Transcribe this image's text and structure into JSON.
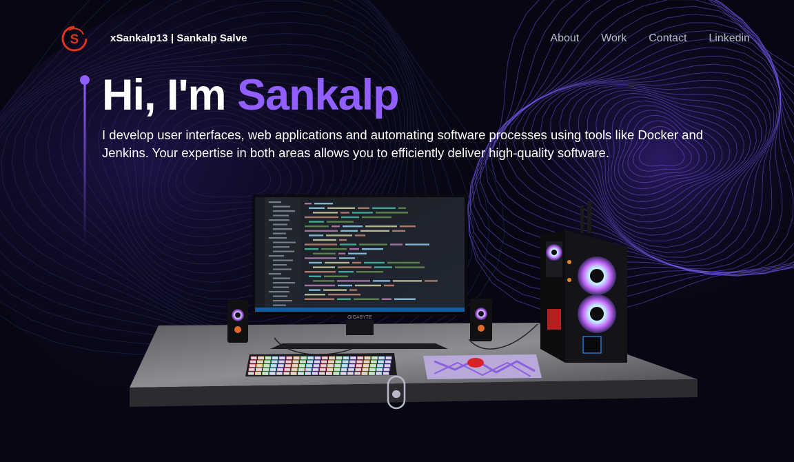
{
  "nav": {
    "brand": "xSankalp13  | Sankalp Salve",
    "logo_letter": "S",
    "links": [
      "About",
      "Work",
      "Contact",
      "Linkedin"
    ]
  },
  "hero": {
    "greeting": "Hi, I'm ",
    "name": "Sankalp",
    "description": "I develop user interfaces, web applications and automating software processes using tools like Docker and Jenkins. Your expertise in both areas allows you to efficiently deliver high-quality software."
  },
  "scene": {
    "monitor_brand": "GIGABYTE"
  },
  "colors": {
    "background": "#070714",
    "accent": "#915eff",
    "logo_red": "#e0321f",
    "nav_text": "#b9b9cc"
  }
}
